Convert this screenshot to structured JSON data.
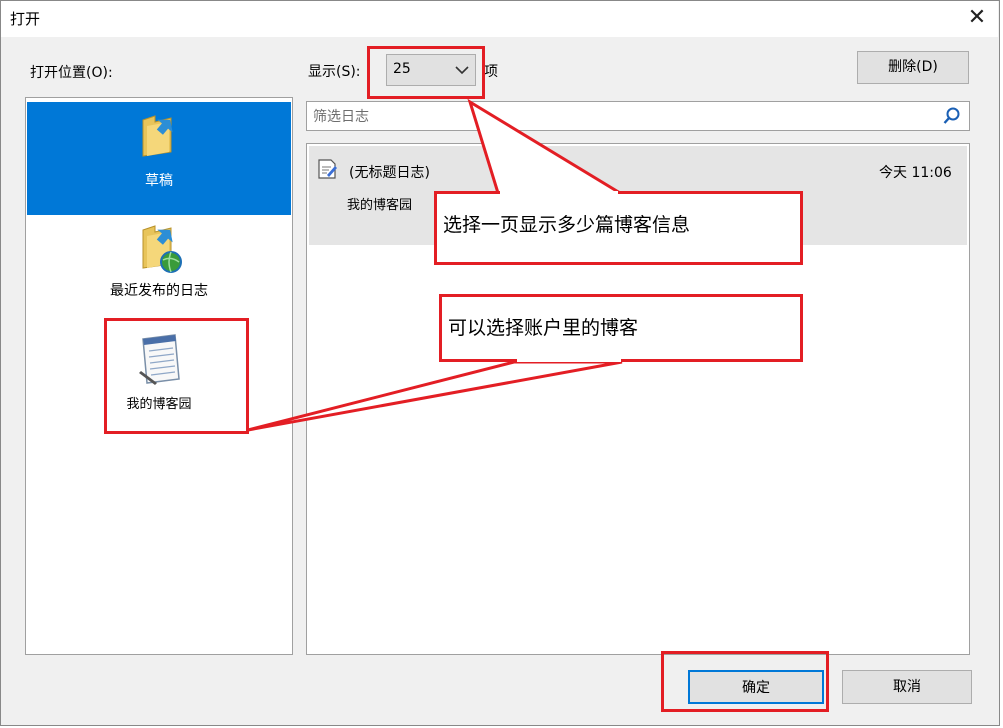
{
  "window": {
    "title": "打开"
  },
  "left": {
    "label": "打开位置(O):",
    "items": [
      {
        "label": "草稿",
        "icon": "folder-arrow-icon",
        "selected": true
      },
      {
        "label": "最近发布的日志",
        "icon": "folder-globe-icon",
        "selected": false
      },
      {
        "label": "我的博客园",
        "icon": "notepad-icon",
        "selected": false
      }
    ]
  },
  "toolbar": {
    "show_label": "显示(S):",
    "show_value": "25",
    "items_label": "项",
    "delete_label": "删除(D)"
  },
  "filter": {
    "placeholder": "筛选日志"
  },
  "list": {
    "rows": [
      {
        "title": "(无标题日志)",
        "subtitle": "我的博客园",
        "time": "今天 11:06"
      }
    ]
  },
  "footer": {
    "ok_label": "确定",
    "cancel_label": "取消"
  },
  "annotations": {
    "callout1": "选择一页显示多少篇博客信息",
    "callout2": "可以选择账户里的博客"
  },
  "colors": {
    "selection": "#0078d7",
    "annotation": "#e31e24"
  }
}
